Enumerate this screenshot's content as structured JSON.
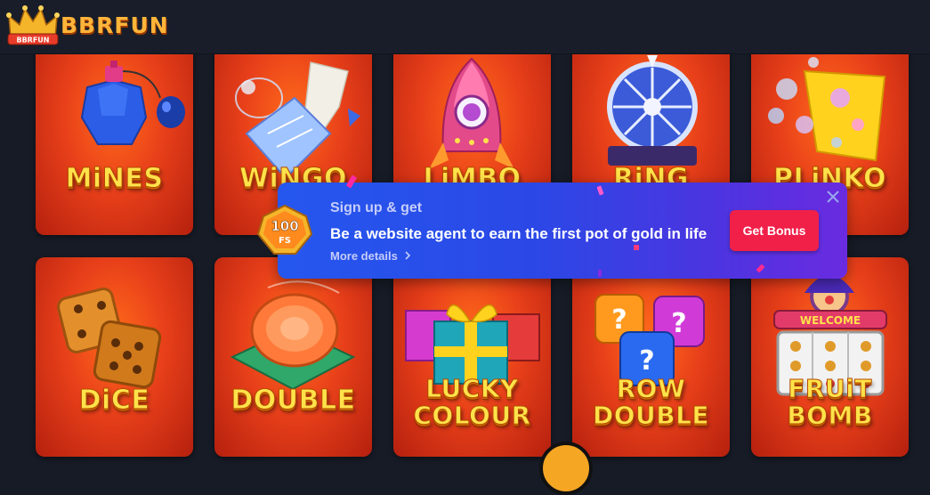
{
  "brand": {
    "name": "BBRFUN",
    "crown_text": "BBRFUN"
  },
  "games": [
    {
      "id": "mines",
      "lines": [
        "MiNES"
      ]
    },
    {
      "id": "wingo",
      "lines": [
        "WiNGO"
      ]
    },
    {
      "id": "limbo",
      "lines": [
        "LiMBO"
      ]
    },
    {
      "id": "ring",
      "lines": [
        "RiNG"
      ]
    },
    {
      "id": "plinko",
      "lines": [
        "PLiNKO"
      ]
    },
    {
      "id": "dice",
      "lines": [
        "DiCE"
      ]
    },
    {
      "id": "double",
      "lines": [
        "DOUBLE"
      ]
    },
    {
      "id": "lucky-colour",
      "lines": [
        "LUCKY",
        "COLOUR"
      ]
    },
    {
      "id": "row-double",
      "lines": [
        "ROW",
        "DOUBLE"
      ]
    },
    {
      "id": "fruit-bomb",
      "lines": [
        "FRUiT",
        "BOMB"
      ],
      "sign": "WELCOME"
    }
  ],
  "popup": {
    "badge_value": "100",
    "badge_unit": "FS",
    "title": "Sign up & get",
    "message": "Be a website agent to earn the first pot of gold in life",
    "link": "More details",
    "link_icon": "chevron-right-icon",
    "cta": "Get Bonus",
    "close_icon": "close-icon"
  },
  "colors": {
    "accent_cta": "#f02049",
    "popup_gradient_start": "#2557ee",
    "popup_gradient_end": "#6a2be0",
    "tile_red": "#e8401a",
    "label_yellow": "#ffe24a",
    "page_background": "#161b26"
  }
}
